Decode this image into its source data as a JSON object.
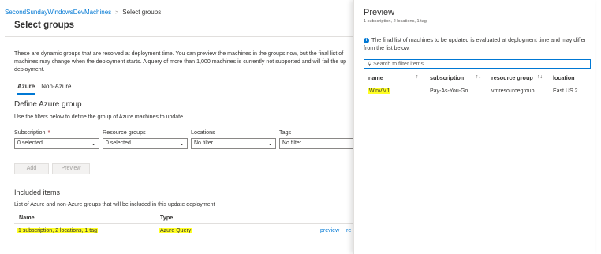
{
  "breadcrumb": {
    "parent": "SecondSundayWindowsDevMachines",
    "current": "Select groups"
  },
  "blade": {
    "title": "Select groups",
    "description_lines": [
      "These are dynamic groups that are resolved at deployment time. You can preview the machines in the groups now, but the final list of",
      "machines may change when the deployment starts. A query of more than 1,000 machines is currently not supported and will fail the up",
      "deployment."
    ],
    "tabs": [
      "Azure",
      "Non-Azure"
    ],
    "active_tab": "Azure",
    "section_title": "Define Azure group",
    "section_subtitle": "Use the filters below to define the group of Azure machines to update",
    "filters": [
      {
        "label": "Subscription",
        "required": "*",
        "value": "0 selected"
      },
      {
        "label": "Resource groups",
        "value": "0 selected"
      },
      {
        "label": "Locations",
        "value": "No filter"
      },
      {
        "label": "Tags",
        "value": "No filter"
      }
    ],
    "buttons": {
      "add": "Add",
      "preview": "Preview"
    },
    "included": {
      "title": "Included items",
      "subtitle": "List of Azure and non-Azure groups that will be included in this update deployment",
      "columns": [
        "Name",
        "Type"
      ],
      "row": {
        "name": "1 subscription, 2 locations, 1 tag",
        "type": "Azure Query",
        "preview_link": "preview",
        "remove_link": "re"
      }
    }
  },
  "preview": {
    "title": "Preview",
    "subtitle": "1 subscription, 2 locations, 1 tag",
    "info": "The final list of machines to be updated is evaluated at deployment time and may differ from the list below.",
    "search_placeholder": "Search to filter items...",
    "columns": [
      "name",
      "subscription",
      "resource group",
      "location"
    ],
    "sort_glyph": "↑↓",
    "sort_glyph_name": "↑",
    "rows": [
      {
        "name": "WinVM1",
        "subscription": "Pay-As-You-Go",
        "resource_group": "vmresourcegroup",
        "location": "East US 2"
      }
    ]
  },
  "colors": {
    "accent": "#0078d4",
    "highlight": "#ffff24",
    "required": "#a4262c"
  }
}
